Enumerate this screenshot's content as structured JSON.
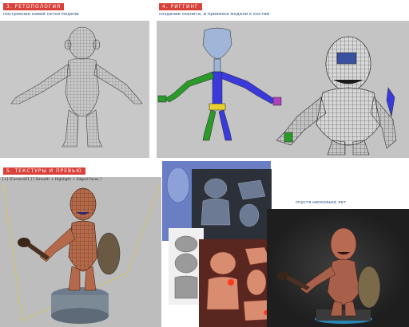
{
  "sections": [
    {
      "heading": "3. РЕТОПОЛОГИЯ",
      "subtitle": "построение новой сетки модели"
    },
    {
      "heading": "4. РИГГИНГ",
      "subtitle": "создание скелета, и привязка модели к костям"
    },
    {
      "heading": "5. ТЕКСТУРЫ И ПРЕВЬЮ",
      "viewport_label": "[+] [Camera01 ] [ Smooth + Highlight + Edged Faces ]"
    }
  ],
  "caption_rig": "спустя несколько лет",
  "colors": {
    "accent": "#d8423a",
    "subtitle": "#2a4f8a",
    "viewport_grey": "#c9c9c9",
    "render_bg": "#232323"
  },
  "icons": [
    "mesh-figure",
    "rig-skeleton",
    "rigged-character",
    "textured-character",
    "uv-map",
    "rendered-character"
  ]
}
